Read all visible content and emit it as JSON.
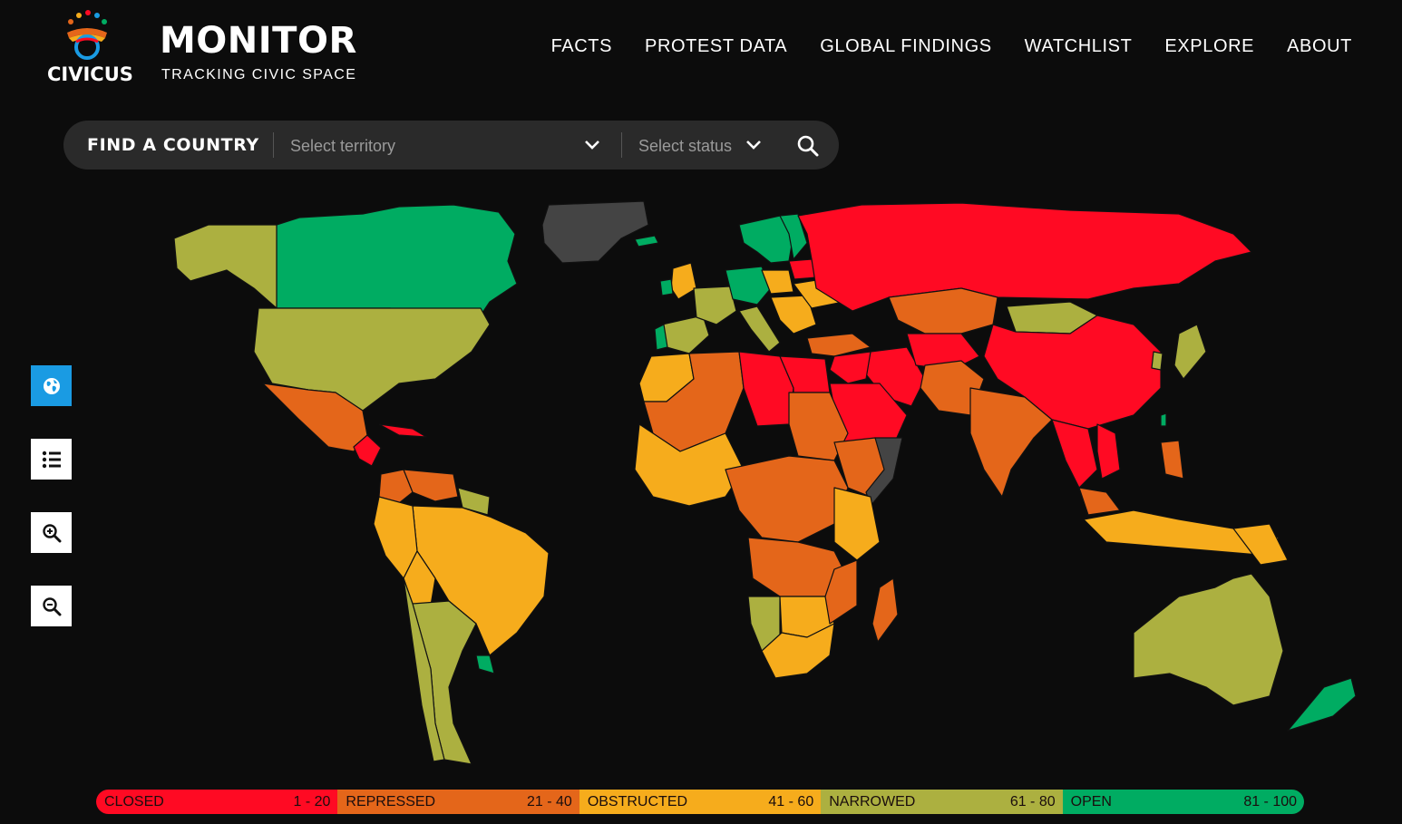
{
  "header": {
    "logo_text": "CIVICUS",
    "title": "MONITOR",
    "subtitle": "TRACKING CIVIC SPACE",
    "nav": [
      "FACTS",
      "PROTEST DATA",
      "GLOBAL FINDINGS",
      "WATCHLIST",
      "EXPLORE",
      "ABOUT"
    ]
  },
  "search": {
    "label": "FIND A COUNTRY",
    "territory_placeholder": "Select territory",
    "status_placeholder": "Select status"
  },
  "tools": {
    "icons": [
      "globe-icon",
      "list-icon",
      "zoom-in-icon",
      "zoom-out-icon"
    ]
  },
  "legend": [
    {
      "label": "CLOSED",
      "range": "1 - 20",
      "color": "#ff0a23"
    },
    {
      "label": "REPRESSED",
      "range": "21 - 40",
      "color": "#e4661a"
    },
    {
      "label": "OBSTRUCTED",
      "range": "41 - 60",
      "color": "#f6ac1c"
    },
    {
      "label": "NARROWED",
      "range": "61 - 80",
      "color": "#acb040"
    },
    {
      "label": "OPEN",
      "range": "81 - 100",
      "color": "#00ac62"
    }
  ],
  "colors": {
    "background": "#0c0c0c",
    "search_bar": "#2a2a2a",
    "active_tool": "#1a9be3",
    "no_data": "#444444"
  }
}
